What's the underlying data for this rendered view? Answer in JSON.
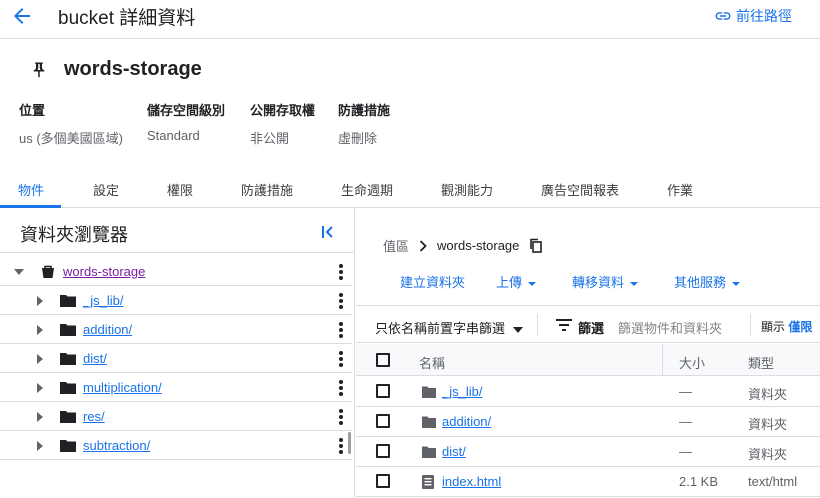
{
  "header": {
    "title": "bucket 詳細資料",
    "goto_label": "前往路徑"
  },
  "bucket": {
    "name": "words-storage",
    "info": [
      {
        "label": "位置",
        "value": "us (多個美國區域)"
      },
      {
        "label": "儲存空間級別",
        "value": "Standard"
      },
      {
        "label": "公開存取權",
        "value": "非公開"
      },
      {
        "label": "防護措施",
        "value": "虛刪除"
      }
    ]
  },
  "tabs": [
    "物件",
    "設定",
    "權限",
    "防護措施",
    "生命週期",
    "觀測能力",
    "廣告空間報表",
    "作業"
  ],
  "active_tab": "物件",
  "browser": {
    "title": "資料夾瀏覽器",
    "root": "words-storage",
    "folders": [
      "_js_lib/",
      "addition/",
      "dist/",
      "multiplication/",
      "res/",
      "subtraction/"
    ]
  },
  "breadcrumb": {
    "root": "值區",
    "current": "words-storage"
  },
  "actions": [
    "建立資料夾",
    "上傳",
    "轉移資料",
    "其他服務"
  ],
  "filter": {
    "prefix_label": "只依名稱前置字串篩選",
    "filter_label": "篩選",
    "placeholder": "篩選物件和資料夾",
    "show_label": "顯示",
    "show_value": "僅限"
  },
  "table": {
    "columns": [
      "名稱",
      "大小",
      "類型"
    ],
    "rows": [
      {
        "name": "_js_lib/",
        "size": "—",
        "type": "資料夾",
        "icon": "folder-icon"
      },
      {
        "name": "addition/",
        "size": "—",
        "type": "資料夾",
        "icon": "folder-icon"
      },
      {
        "name": "dist/",
        "size": "—",
        "type": "資料夾",
        "icon": "folder-icon"
      },
      {
        "name": "index.html",
        "size": "2.1 KB",
        "type": "text/html",
        "icon": "file-icon"
      }
    ]
  },
  "colors": {
    "accent": "#1a73e8",
    "root_link": "#7b1fa2",
    "border": "#dadce0"
  }
}
